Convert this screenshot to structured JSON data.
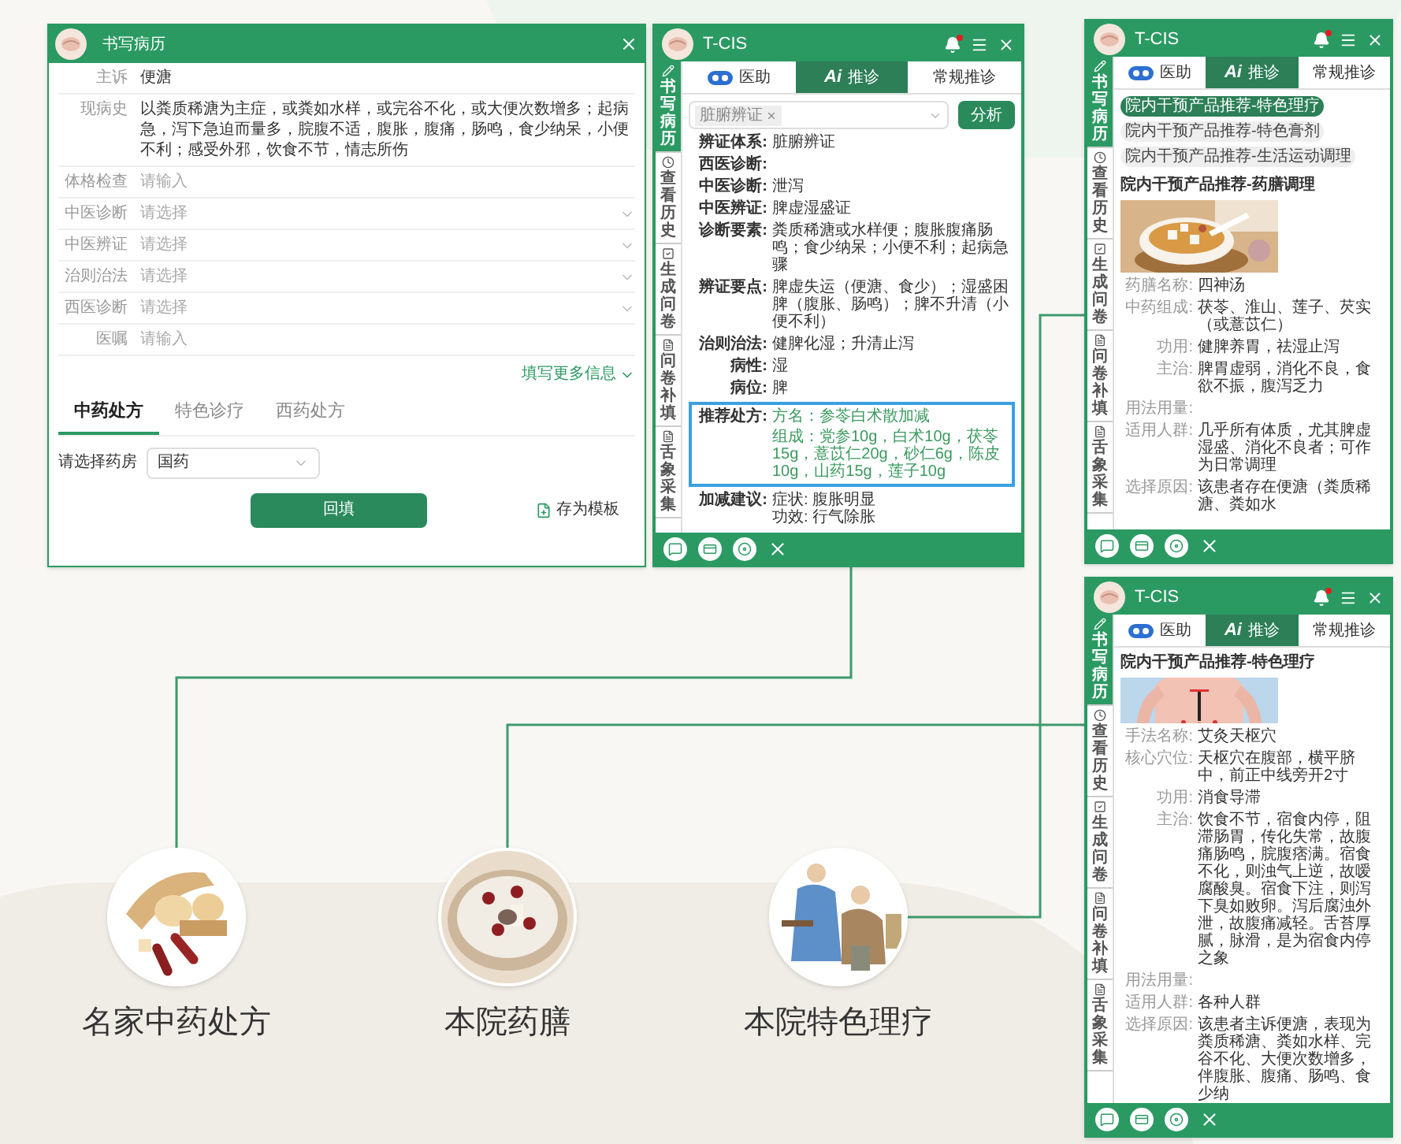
{
  "record_window": {
    "title": "书写病历",
    "fields": [
      {
        "label": "主诉",
        "kind": "text",
        "value": "便溏"
      },
      {
        "label": "现病史",
        "kind": "text",
        "value": "以粪质稀溏为主症，或粪如水样，或完谷不化，或大便次数增多；起病急，泻下急迫而量多，脘腹不适，腹胀，腹痛，肠鸣，食少纳呆，小便不利；感受外邪，饮食不节，情志所伤"
      },
      {
        "label": "体格检查",
        "kind": "text",
        "placeholder": "请输入"
      },
      {
        "label": "中医诊断",
        "kind": "select",
        "placeholder": "请选择"
      },
      {
        "label": "中医辨证",
        "kind": "select",
        "placeholder": "请选择"
      },
      {
        "label": "治则治法",
        "kind": "select",
        "placeholder": "请选择"
      },
      {
        "label": "西医诊断",
        "kind": "select",
        "placeholder": "请选择"
      },
      {
        "label": "医嘱",
        "kind": "text",
        "placeholder": "请输入"
      }
    ],
    "more_link": "填写更多信息",
    "tabs": [
      {
        "label": "中药处方",
        "selected": true
      },
      {
        "label": "特色诊疗",
        "selected": false
      },
      {
        "label": "西药处方",
        "selected": false
      }
    ],
    "pharmacy": {
      "label": "请选择药房",
      "value": "国药"
    },
    "submit_button": "回填",
    "save_template": "存为模板"
  },
  "assistant_window": {
    "title": "T-CIS",
    "sidebar": [
      {
        "kind": "pen",
        "label": "书写病历",
        "selected": true
      },
      {
        "kind": "clock",
        "label": "查看历史",
        "selected": false
      },
      {
        "kind": "form",
        "label": "生成问卷",
        "selected": false
      },
      {
        "kind": "doc",
        "label": "问卷补填",
        "selected": false
      },
      {
        "kind": "doc",
        "label": "舌象采集",
        "selected": false
      }
    ],
    "tabs": [
      {
        "kind": "eyes",
        "label": "医助",
        "selected": false
      },
      {
        "kind": "ai",
        "logo": "Ai",
        "label": "推诊",
        "selected": true
      },
      {
        "kind": "plain",
        "label": "常规推诊",
        "selected": false
      }
    ],
    "tag": "脏腑辨证",
    "analyze_button": "分析",
    "rows": [
      {
        "label": "辨证体系:",
        "value": "脏腑辨证"
      },
      {
        "label": "西医诊断:"
      },
      {
        "label": "中医诊断:",
        "value": "泄泻"
      },
      {
        "label": "中医辨证:",
        "value": "脾虚湿盛证"
      },
      {
        "label": "诊断要素:",
        "value": "粪质稀溏或水样便；腹胀腹痛肠鸣；食少纳呆；小便不利；起病急骤"
      },
      {
        "label": "辨证要点:",
        "value": "脾虚失运（便溏、食少）；湿盛困脾（腹胀、肠鸣）；脾不升清（小便不利）"
      },
      {
        "label": "治则治法:",
        "value": "健脾化湿；升清止泻"
      },
      {
        "label": "病性:",
        "value": "湿"
      },
      {
        "label": "病位:",
        "value": "脾"
      }
    ],
    "recommendation": {
      "label": "推荐处方:",
      "highlighted": true,
      "lines": [
        "方名：参苓白术散加减",
        "组成：党参10g，白术10g，茯苓15g，薏苡仁20g，砂仁6g，陈皮10g，山药15g，莲子10g"
      ]
    },
    "adjust": {
      "label": "加减建议:",
      "lines": [
        "症状: 腹胀明显",
        "功效: 行气除胀"
      ]
    }
  },
  "diet_window": {
    "title": "T-CIS",
    "sidebar": [
      {
        "kind": "pen",
        "label": "书写病历",
        "selected": true
      },
      {
        "kind": "clock",
        "label": "查看历史",
        "selected": false
      },
      {
        "kind": "form",
        "label": "生成问卷",
        "selected": false
      },
      {
        "kind": "doc",
        "label": "问卷补填",
        "selected": false
      },
      {
        "kind": "doc",
        "label": "舌象采集",
        "selected": false
      }
    ],
    "tabs": [
      {
        "kind": "eyes",
        "label": "医助",
        "selected": false
      },
      {
        "kind": "ai",
        "logo": "Ai",
        "label": "推诊",
        "selected": true
      },
      {
        "kind": "plain",
        "label": "常规推诊",
        "selected": false
      }
    ],
    "chips": [
      {
        "label": "院内干预产品推荐-特色理疗",
        "selected": true
      },
      {
        "label": "院内干预产品推荐-特色膏剂",
        "selected": false
      },
      {
        "label": "院内干预产品推荐-生活运动调理",
        "selected": false
      }
    ],
    "heading": "院内干预产品推荐-药膳调理",
    "rows": [
      {
        "label": "药膳名称:",
        "value": "四神汤"
      },
      {
        "label": "中药组成:",
        "value": "茯苓、淮山、莲子、芡实（或薏苡仁）"
      },
      {
        "label": "功用:",
        "value": "健脾养胃，祛湿止泻"
      },
      {
        "label": "主治:",
        "value": "脾胃虚弱，消化不良，食欲不振，腹泻乏力"
      },
      {
        "label": "用法用量:"
      },
      {
        "label": "适用人群:",
        "value": "几乎所有体质，尤其脾虚湿盛、消化不良者；可作为日常调理"
      },
      {
        "label": "选择原因:",
        "value": "该患者存在便溏（粪质稀溏、粪如水"
      }
    ]
  },
  "therapy_window": {
    "title": "T-CIS",
    "sidebar": [
      {
        "kind": "pen",
        "label": "书写病历",
        "selected": true
      },
      {
        "kind": "clock",
        "label": "查看历史",
        "selected": false
      },
      {
        "kind": "form",
        "label": "生成问卷",
        "selected": false
      },
      {
        "kind": "doc",
        "label": "问卷补填",
        "selected": false
      },
      {
        "kind": "doc",
        "label": "舌象采集",
        "selected": false
      }
    ],
    "tabs": [
      {
        "kind": "eyes",
        "label": "医助",
        "selected": false
      },
      {
        "kind": "ai",
        "logo": "Ai",
        "label": "推诊",
        "selected": true
      },
      {
        "kind": "plain",
        "label": "常规推诊",
        "selected": false
      }
    ],
    "heading": "院内干预产品推荐-特色理疗",
    "rows": [
      {
        "label": "手法名称:",
        "value": "艾灸天枢穴"
      },
      {
        "label": "核心穴位:",
        "value": "天枢穴在腹部，横平脐中，前正中线旁开2寸"
      },
      {
        "label": "功用:",
        "value": "消食导滞"
      },
      {
        "label": "主治:",
        "value": "饮食不节，宿食内停，阻滞肠胃，传化失常，故腹痛肠鸣，脘腹痞满。宿食不化，则浊气上逆，故嗳腐酸臭。宿食下注，则泻下臭如败卵。泻后腐浊外泄，故腹痛减轻。舌苔厚腻，脉滑，是为宿食内停之象"
      },
      {
        "label": "用法用量:"
      },
      {
        "label": "适用人群:",
        "value": "各种人群"
      },
      {
        "label": "选择原因:",
        "value": "该患者主诉便溏，表现为粪质稀溏、粪如水样、完谷不化、大便次数增多，伴腹胀、腹痛、肠鸣、食少纳"
      }
    ]
  },
  "features": [
    {
      "label": "名家中药处方",
      "kind": "picture"
    },
    {
      "label": "本院药膳",
      "kind": "picture"
    },
    {
      "label": "本院特色理疗",
      "kind": "picture"
    }
  ]
}
